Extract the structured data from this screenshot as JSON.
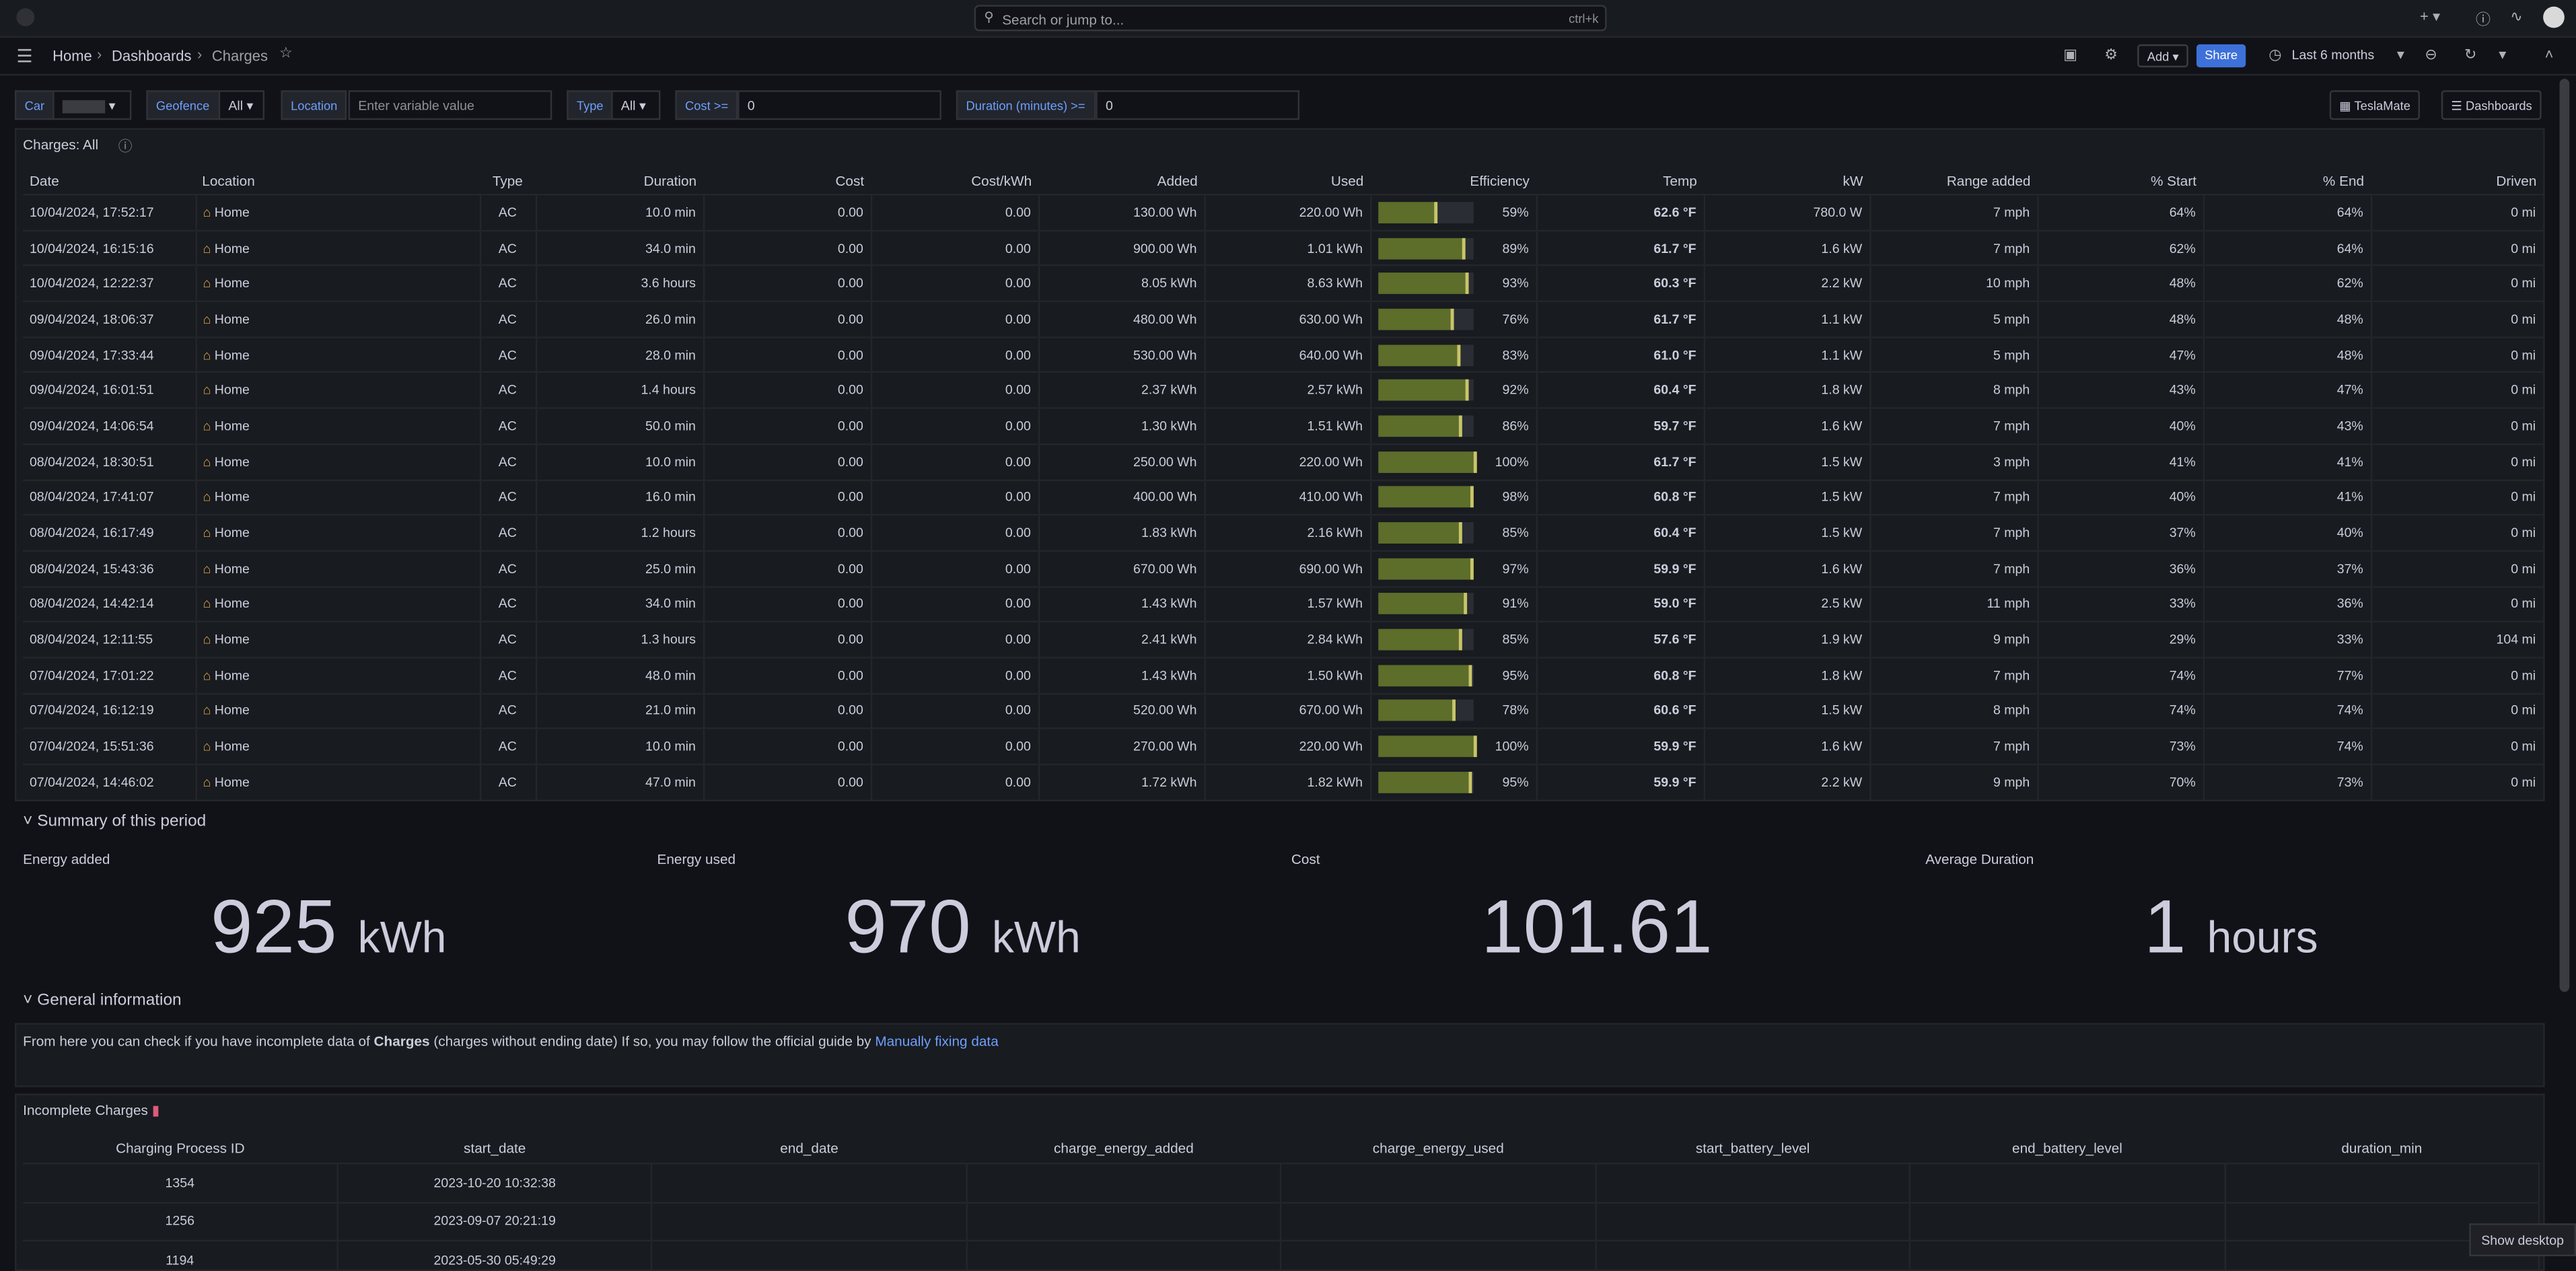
{
  "topbar": {
    "search_placeholder": "Search or jump to...",
    "search_shortcut": "ctrl+k"
  },
  "breadcrumb": [
    "Home",
    "Dashboards",
    "Charges"
  ],
  "toolbar": {
    "add_label": "Add",
    "share_label": "Share",
    "time_range": "Last 6 months"
  },
  "variables": {
    "car_label": "Car",
    "geofence_label": "Geofence",
    "geofence_value": "All",
    "location_label": "Location",
    "location_placeholder": "Enter variable value",
    "type_label": "Type",
    "type_value": "All",
    "cost_label": "Cost >=",
    "cost_value": "0",
    "duration_label": "Duration (minutes) >=",
    "duration_value": "0",
    "teslamate_link": "TeslaMate",
    "dashboards_link": "Dashboards"
  },
  "charges_panel": {
    "title": "Charges: All",
    "columns": [
      "Date",
      "Location",
      "Type",
      "Duration",
      "Cost",
      "Cost/kWh",
      "Added",
      "Used",
      "Efficiency",
      "Temp",
      "kW",
      "Range added",
      "% Start",
      "% End",
      "Driven"
    ],
    "rows": [
      [
        "10/04/2024, 17:52:17",
        "Home",
        "AC",
        "10.0 min",
        "0.00",
        "0.00",
        "130.00 Wh",
        "220.00 Wh",
        "59%",
        "62.6 °F",
        "780.0 W",
        "7 mph",
        "64%",
        "64%",
        "0 mi"
      ],
      [
        "10/04/2024, 16:15:16",
        "Home",
        "AC",
        "34.0 min",
        "0.00",
        "0.00",
        "900.00 Wh",
        "1.01 kWh",
        "89%",
        "61.7 °F",
        "1.6 kW",
        "7 mph",
        "62%",
        "64%",
        "0 mi"
      ],
      [
        "10/04/2024, 12:22:37",
        "Home",
        "AC",
        "3.6 hours",
        "0.00",
        "0.00",
        "8.05 kWh",
        "8.63 kWh",
        "93%",
        "60.3 °F",
        "2.2 kW",
        "10 mph",
        "48%",
        "62%",
        "0 mi"
      ],
      [
        "09/04/2024, 18:06:37",
        "Home",
        "AC",
        "26.0 min",
        "0.00",
        "0.00",
        "480.00 Wh",
        "630.00 Wh",
        "76%",
        "61.7 °F",
        "1.1 kW",
        "5 mph",
        "48%",
        "48%",
        "0 mi"
      ],
      [
        "09/04/2024, 17:33:44",
        "Home",
        "AC",
        "28.0 min",
        "0.00",
        "0.00",
        "530.00 Wh",
        "640.00 Wh",
        "83%",
        "61.0 °F",
        "1.1 kW",
        "5 mph",
        "47%",
        "48%",
        "0 mi"
      ],
      [
        "09/04/2024, 16:01:51",
        "Home",
        "AC",
        "1.4 hours",
        "0.00",
        "0.00",
        "2.37 kWh",
        "2.57 kWh",
        "92%",
        "60.4 °F",
        "1.8 kW",
        "8 mph",
        "43%",
        "47%",
        "0 mi"
      ],
      [
        "09/04/2024, 14:06:54",
        "Home",
        "AC",
        "50.0 min",
        "0.00",
        "0.00",
        "1.30 kWh",
        "1.51 kWh",
        "86%",
        "59.7 °F",
        "1.6 kW",
        "7 mph",
        "40%",
        "43%",
        "0 mi"
      ],
      [
        "08/04/2024, 18:30:51",
        "Home",
        "AC",
        "10.0 min",
        "0.00",
        "0.00",
        "250.00 Wh",
        "220.00 Wh",
        "100%",
        "61.7 °F",
        "1.5 kW",
        "3 mph",
        "41%",
        "41%",
        "0 mi"
      ],
      [
        "08/04/2024, 17:41:07",
        "Home",
        "AC",
        "16.0 min",
        "0.00",
        "0.00",
        "400.00 Wh",
        "410.00 Wh",
        "98%",
        "60.8 °F",
        "1.5 kW",
        "7 mph",
        "40%",
        "41%",
        "0 mi"
      ],
      [
        "08/04/2024, 16:17:49",
        "Home",
        "AC",
        "1.2 hours",
        "0.00",
        "0.00",
        "1.83 kWh",
        "2.16 kWh",
        "85%",
        "60.4 °F",
        "1.5 kW",
        "7 mph",
        "37%",
        "40%",
        "0 mi"
      ],
      [
        "08/04/2024, 15:43:36",
        "Home",
        "AC",
        "25.0 min",
        "0.00",
        "0.00",
        "670.00 Wh",
        "690.00 Wh",
        "97%",
        "59.9 °F",
        "1.6 kW",
        "7 mph",
        "36%",
        "37%",
        "0 mi"
      ],
      [
        "08/04/2024, 14:42:14",
        "Home",
        "AC",
        "34.0 min",
        "0.00",
        "0.00",
        "1.43 kWh",
        "1.57 kWh",
        "91%",
        "59.0 °F",
        "2.5 kW",
        "11 mph",
        "33%",
        "36%",
        "0 mi"
      ],
      [
        "08/04/2024, 12:11:55",
        "Home",
        "AC",
        "1.3 hours",
        "0.00",
        "0.00",
        "2.41 kWh",
        "2.84 kWh",
        "85%",
        "57.6 °F",
        "1.9 kW",
        "9 mph",
        "29%",
        "33%",
        "104 mi"
      ],
      [
        "07/04/2024, 17:01:22",
        "Home",
        "AC",
        "48.0 min",
        "0.00",
        "0.00",
        "1.43 kWh",
        "1.50 kWh",
        "95%",
        "60.8 °F",
        "1.8 kW",
        "7 mph",
        "74%",
        "77%",
        "0 mi"
      ],
      [
        "07/04/2024, 16:12:19",
        "Home",
        "AC",
        "21.0 min",
        "0.00",
        "0.00",
        "520.00 Wh",
        "670.00 Wh",
        "78%",
        "60.6 °F",
        "1.5 kW",
        "8 mph",
        "74%",
        "74%",
        "0 mi"
      ],
      [
        "07/04/2024, 15:51:36",
        "Home",
        "AC",
        "10.0 min",
        "0.00",
        "0.00",
        "270.00 Wh",
        "220.00 Wh",
        "100%",
        "59.9 °F",
        "1.6 kW",
        "7 mph",
        "73%",
        "74%",
        "0 mi"
      ],
      [
        "07/04/2024, 14:46:02",
        "Home",
        "AC",
        "47.0 min",
        "0.00",
        "0.00",
        "1.72 kWh",
        "1.82 kWh",
        "95%",
        "59.9 °F",
        "2.2 kW",
        "9 mph",
        "70%",
        "73%",
        "0 mi"
      ]
    ],
    "efficiency_fraction": [
      0.59,
      0.89,
      0.93,
      0.76,
      0.83,
      0.92,
      0.86,
      1.0,
      0.98,
      0.85,
      0.97,
      0.91,
      0.85,
      0.95,
      0.78,
      1.0,
      0.95
    ]
  },
  "summary": {
    "section_title": "Summary of this period",
    "energy_added_title": "Energy added",
    "energy_added_value": "925",
    "energy_added_unit": "kWh",
    "energy_used_title": "Energy used",
    "energy_used_value": "970",
    "energy_used_unit": "kWh",
    "cost_title": "Cost",
    "cost_value": "101.61",
    "avg_duration_title": "Average Duration",
    "avg_duration_value": "1",
    "avg_duration_unit": "hours"
  },
  "general": {
    "section_title": "General information",
    "text_prefix": "From here you can check if you have incomplete data of ",
    "text_bold": "Charges",
    "text_middle": " (charges without ending date) If so, you may follow the official guide by ",
    "link": "Manually fixing data"
  },
  "incomplete": {
    "title": "Incomplete Charges",
    "columns": [
      "Charging Process ID",
      "start_date",
      "end_date",
      "charge_energy_added",
      "charge_energy_used",
      "start_battery_level",
      "end_battery_level",
      "duration_min"
    ],
    "rows": [
      [
        "1354",
        "2023-10-20 10:32:38",
        "",
        "",
        "",
        "",
        "",
        ""
      ],
      [
        "1256",
        "2023-09-07 20:21:19",
        "",
        "",
        "",
        "",
        "",
        ""
      ],
      [
        "1194",
        "2023-05-30 05:49:29",
        "",
        "",
        "",
        "",
        "",
        ""
      ]
    ]
  },
  "taskbar": {
    "show_desktop": "Show desktop"
  },
  "colors": {
    "background": "#111217",
    "panel": "#181b1f",
    "link": "#6e9fff",
    "temp": "#b9dd79",
    "kw": "#73bf69",
    "share": "#3d71d9"
  }
}
